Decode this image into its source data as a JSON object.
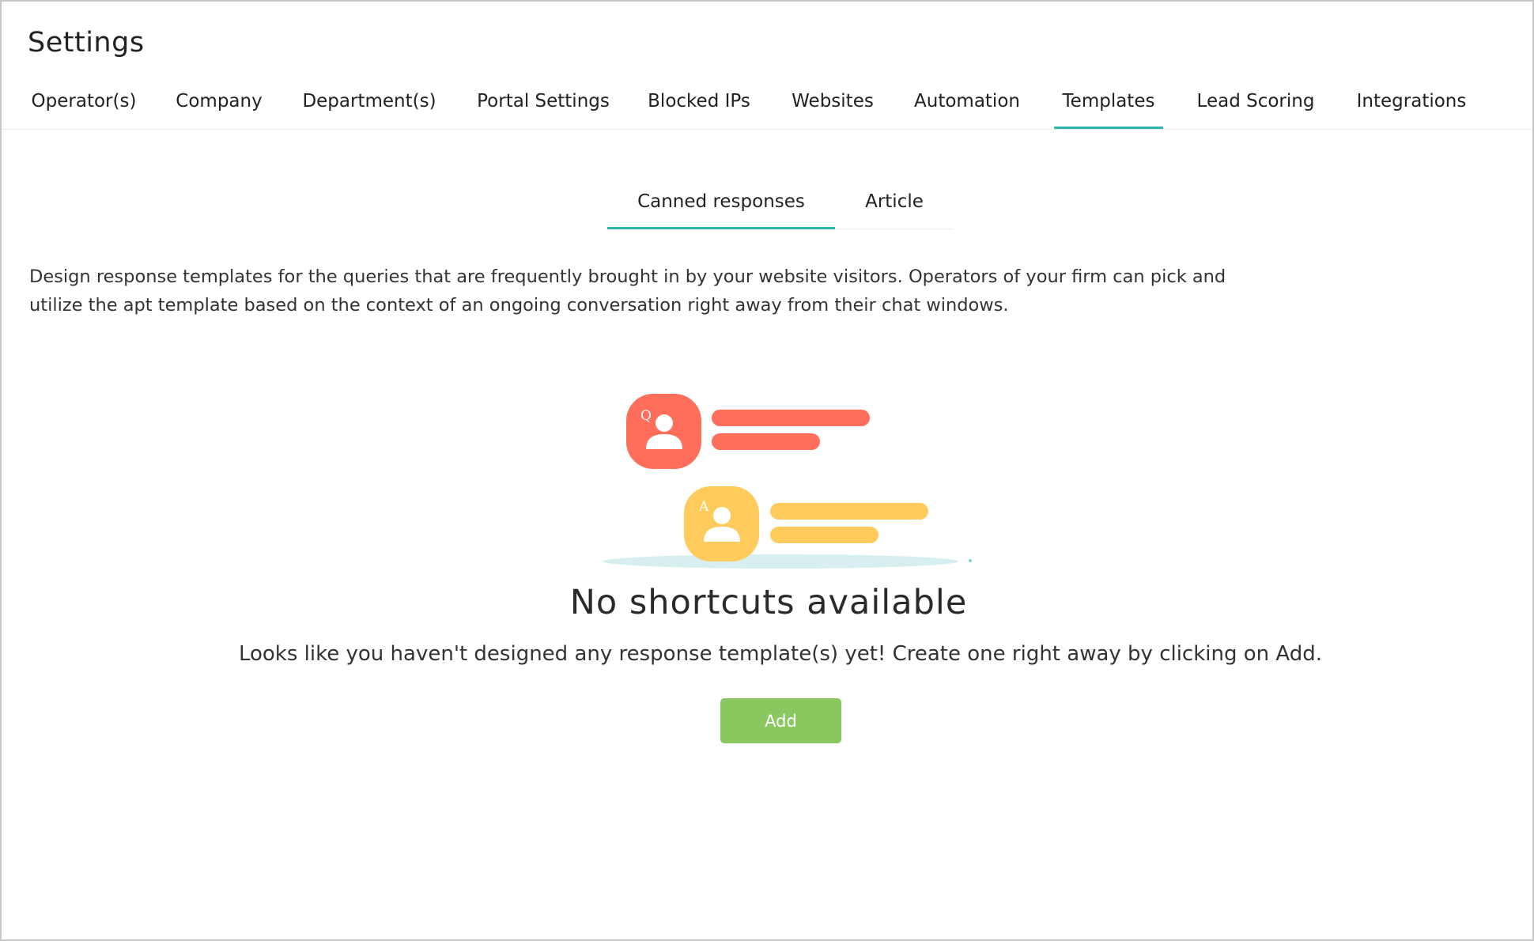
{
  "page": {
    "title": "Settings"
  },
  "main_tabs": [
    {
      "label": "Operator(s)",
      "active": false
    },
    {
      "label": "Company",
      "active": false
    },
    {
      "label": "Department(s)",
      "active": false
    },
    {
      "label": "Portal Settings",
      "active": false
    },
    {
      "label": "Blocked IPs",
      "active": false
    },
    {
      "label": "Websites",
      "active": false
    },
    {
      "label": "Automation",
      "active": false
    },
    {
      "label": "Templates",
      "active": true
    },
    {
      "label": "Lead Scoring",
      "active": false
    },
    {
      "label": "Integrations",
      "active": false
    }
  ],
  "sub_tabs": [
    {
      "label": "Canned responses",
      "active": true
    },
    {
      "label": "Article",
      "active": false
    }
  ],
  "description": "Design response templates for the queries that are frequently brought in by your website visitors. Operators of your firm can pick and utilize the apt template based on the context of an ongoing conversation right away from their chat windows.",
  "empty_state": {
    "question_badge": "Q",
    "answer_badge": "A",
    "title": "No shortcuts available",
    "message": "Looks like you haven't designed any response template(s) yet! Create one right away by clicking on Add.",
    "add_label": "Add"
  },
  "colors": {
    "accent": "#2fb5ad",
    "question": "#ff6e5a",
    "answer": "#ffcb5c",
    "button": "#8ac85f",
    "shadow": "#d7eff0"
  }
}
